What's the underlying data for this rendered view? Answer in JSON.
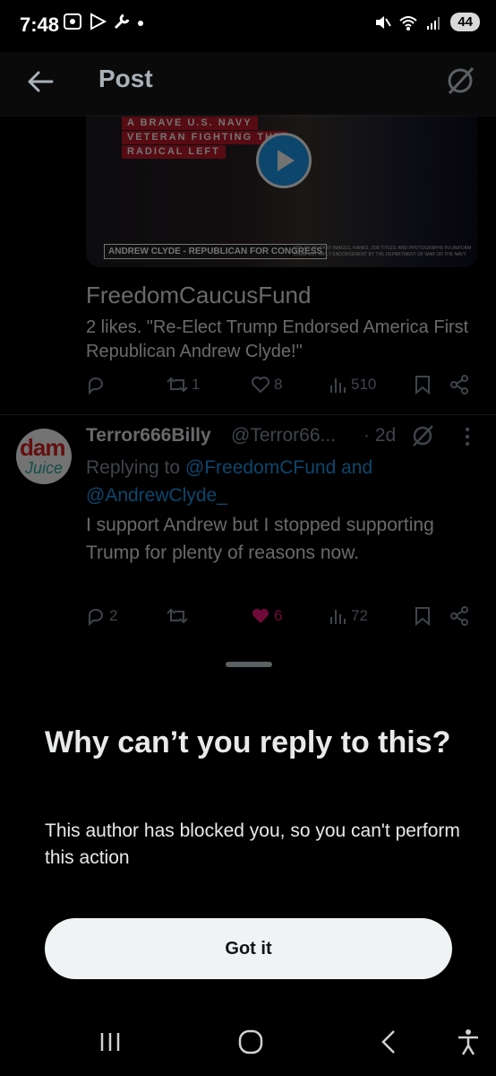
{
  "status_bar": {
    "time": "7:48",
    "battery": "44"
  },
  "header": {
    "title": "Post"
  },
  "video": {
    "line1": "A BRAVE U.S. NAVY",
    "line2": "VETERAN FIGHTING THE",
    "line3": "RADICAL LEFT",
    "caption": "ANDREW CLYDE - REPUBLICAN FOR CONGRESS",
    "disclaimer": "USE OF MILITARY IMAGES, RANKS, JOB TITLES, AND PHOTOGRAPHS IN UNIFORM DOES NOT IMPLY ENDORSEMENT BY THE DEPARTMENT OF WAR OR THE NAVY."
  },
  "quoted_post": {
    "author": "FreedomCaucusFund",
    "text": "2 likes. \"Re-Elect Trump Endorsed America First Republican Andrew Clyde!\"",
    "retweets": "1",
    "likes": "8",
    "views": "510"
  },
  "reply": {
    "avatar_text1": "dam",
    "avatar_text2": "Juice",
    "display_name": "Terror666Billy",
    "handle": "@Terror66...",
    "time": "· 2d",
    "replying_prefix": "Replying to ",
    "replying_to1": "@FreedomCFund",
    "replying_and": " and ",
    "replying_to2": "@AndrewClyde_",
    "text": "I support Andrew but I stopped supporting Trump for plenty of reasons now.",
    "replies": "2",
    "likes": "6",
    "views": "72",
    "like_color": "#f91880"
  },
  "sheet": {
    "title": "Why can’t you reply to this?",
    "description": "This author has blocked you, so you can't perform this action",
    "button": "Got it"
  }
}
